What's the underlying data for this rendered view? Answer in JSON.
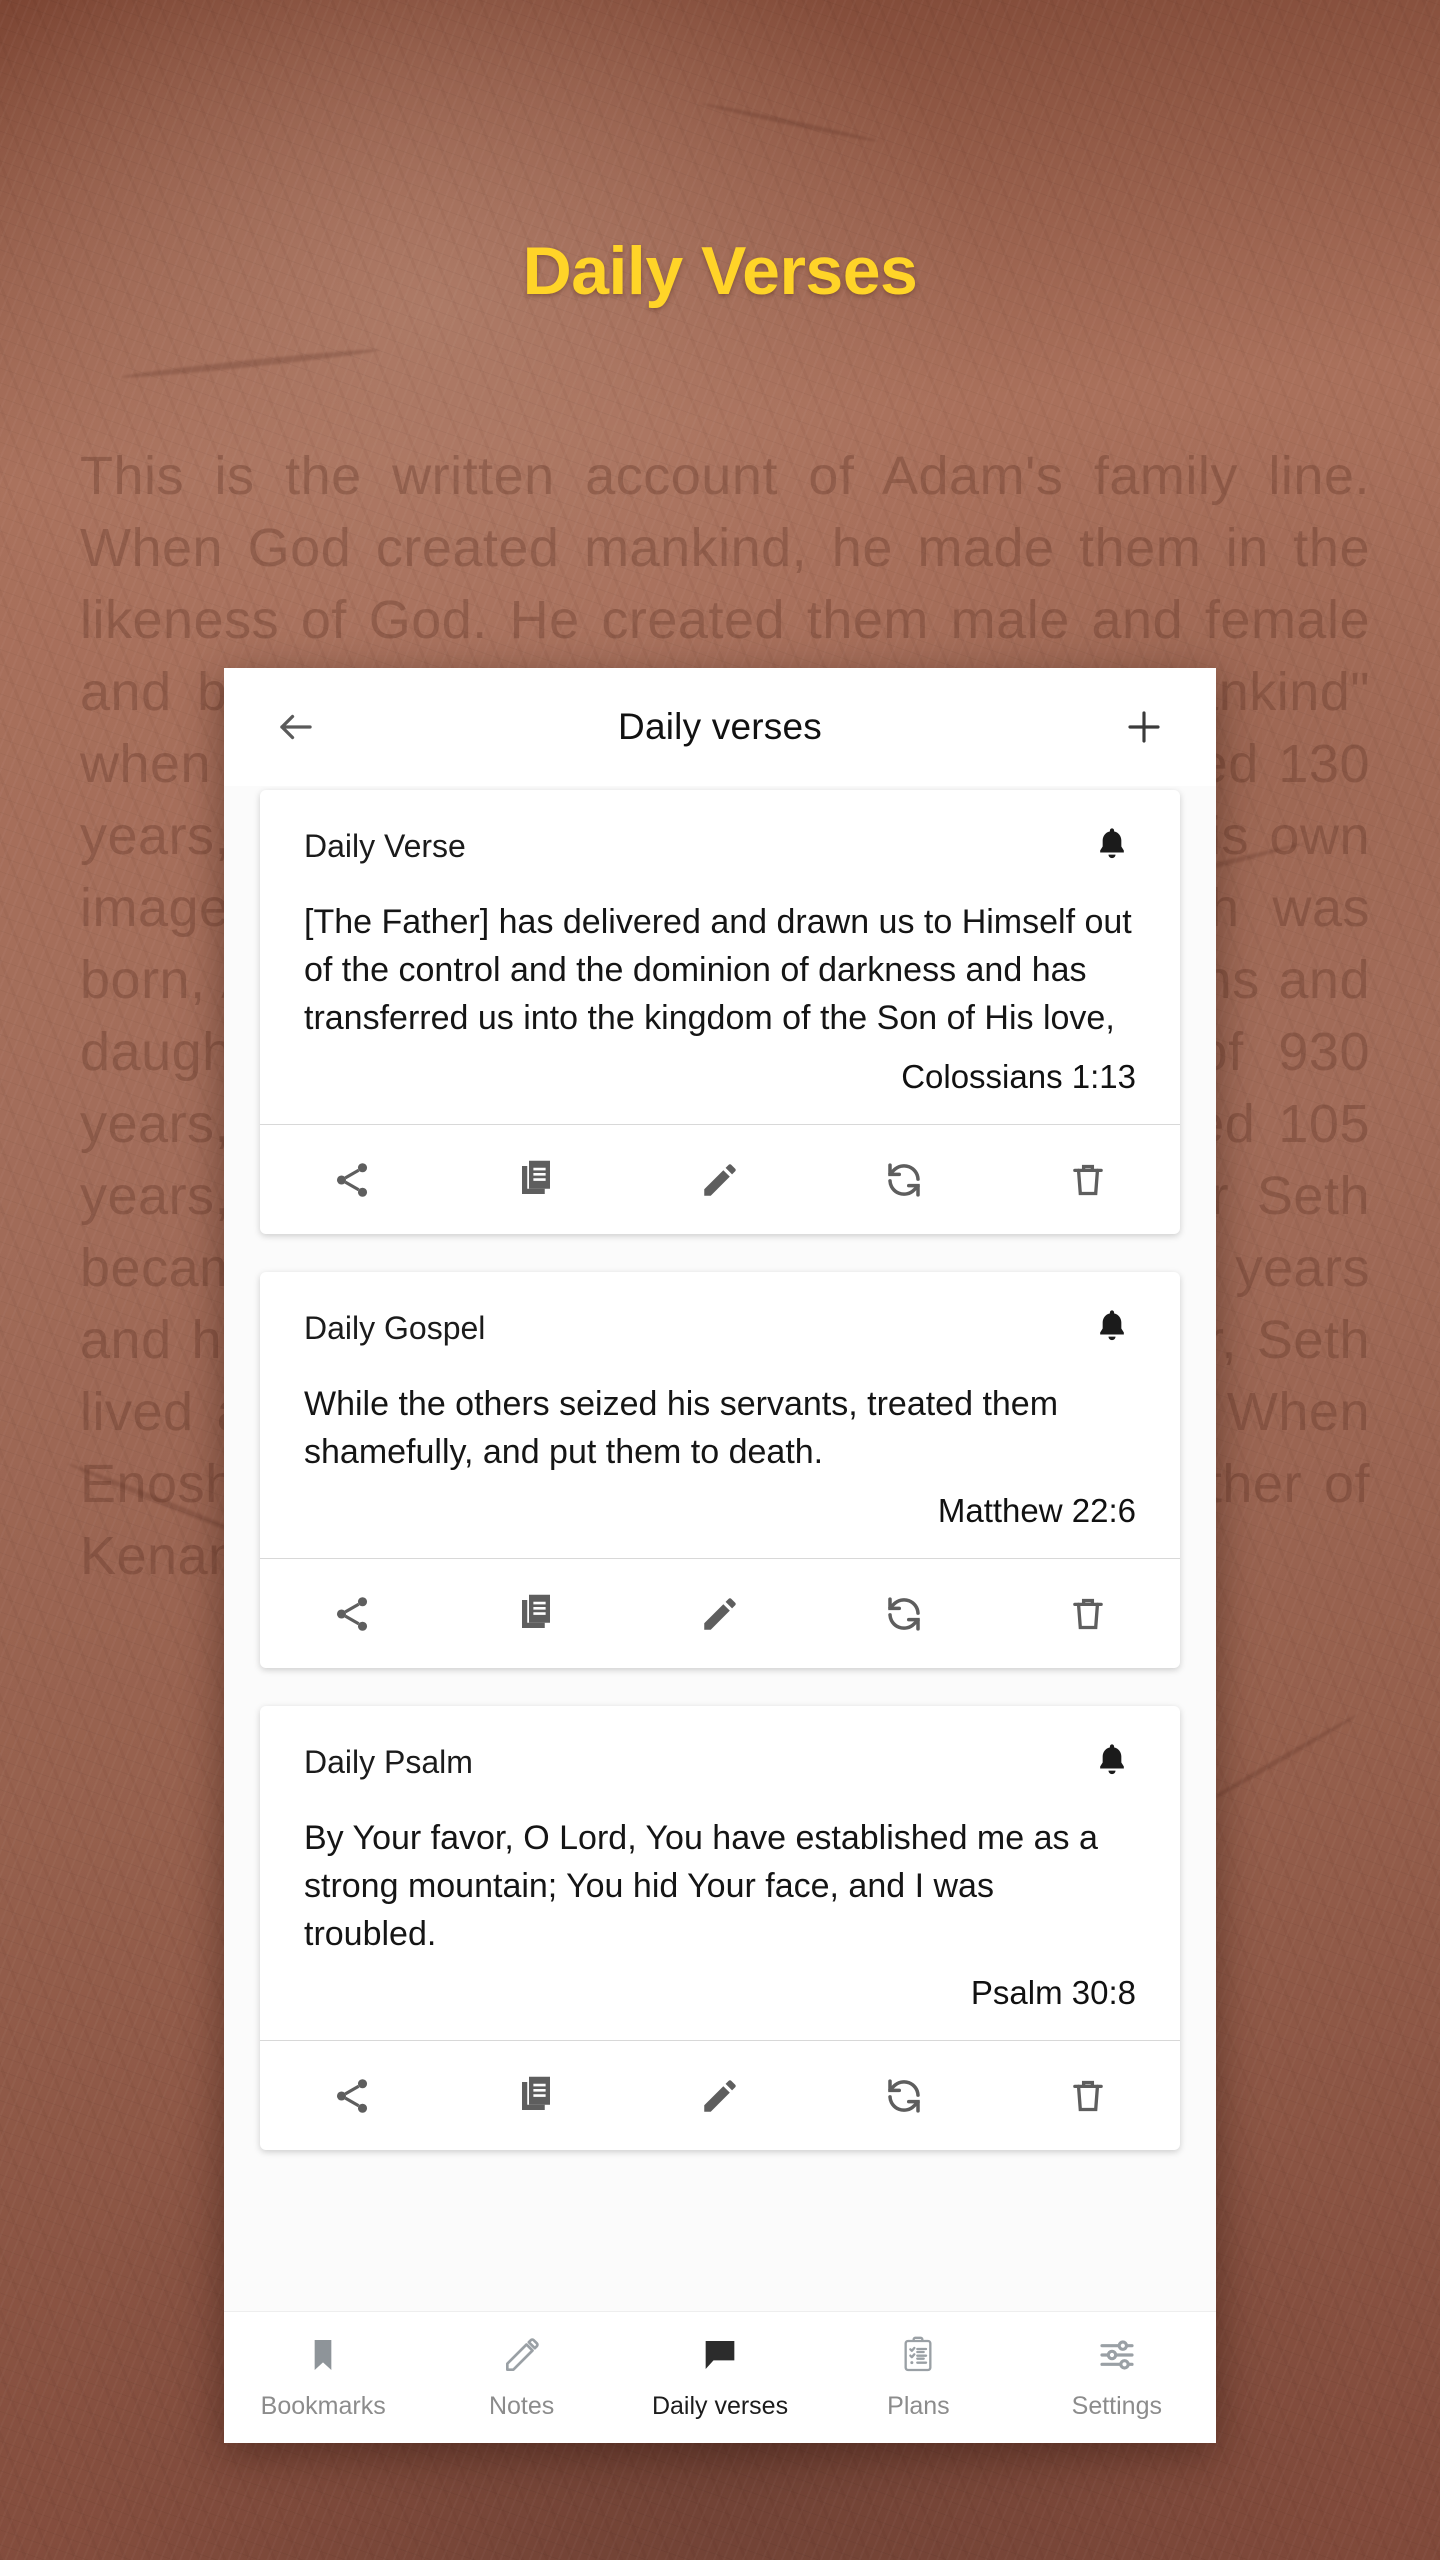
{
  "hero": {
    "title": "Daily Verses",
    "color": "#FFD428"
  },
  "background": {
    "scripture_text": "This is the written account of Adam's family line. When God created mankind, he made them in the likeness of God. He created them male and female and blessed them. And he named them \"Mankind\" when they were created. When Adam had lived 130 years, he had a son in his own likeness, in his own image; and he named him Seth. After Seth was born, Adam lived 800 years and had other sons and daughters. Altogether, Adam lived a total of 930 years, and then he died. When Seth had lived 105 years, he became the father of Enosh. After Seth became the father of Enosh, Seth lived 807 years and had other sons and daughters. Altogether, Seth lived a total of 912 years, and then he died. When Enosh had lived 90 years, he became the father of Kenan."
  },
  "appbar": {
    "back_icon": "arrow-left-icon",
    "title": "Daily verses",
    "add_icon": "plus-icon"
  },
  "actions": [
    {
      "name": "share",
      "icon": "share-icon"
    },
    {
      "name": "copy",
      "icon": "copy-icon"
    },
    {
      "name": "edit",
      "icon": "pencil-icon"
    },
    {
      "name": "refresh",
      "icon": "refresh-icon"
    },
    {
      "name": "delete",
      "icon": "trash-icon"
    }
  ],
  "cards": [
    {
      "title": "Daily Verse",
      "bell_icon": "bell-icon",
      "text": "[The Father] has delivered and drawn us to Himself out of the control and the dominion of darkness and has transferred us into the kingdom of the Son of His love,",
      "reference": "Colossians 1:13"
    },
    {
      "title": "Daily Gospel",
      "bell_icon": "bell-icon",
      "text": "While the others seized his servants, treated them shamefully, and put them to death.",
      "reference": "Matthew 22:6"
    },
    {
      "title": "Daily Psalm",
      "bell_icon": "bell-icon",
      "text": "By Your favor, O Lord, You have established me as a strong mountain; You hid Your face, and I was troubled.",
      "reference": "Psalm 30:8"
    }
  ],
  "bottom_nav": {
    "active": "Daily verses",
    "items": [
      {
        "label": "Bookmarks",
        "icon": "bookmark-icon"
      },
      {
        "label": "Notes",
        "icon": "pencil-icon"
      },
      {
        "label": "Daily verses",
        "icon": "speech-bubble-icon"
      },
      {
        "label": "Plans",
        "icon": "clipboard-list-icon"
      },
      {
        "label": "Settings",
        "icon": "sliders-icon"
      }
    ]
  }
}
